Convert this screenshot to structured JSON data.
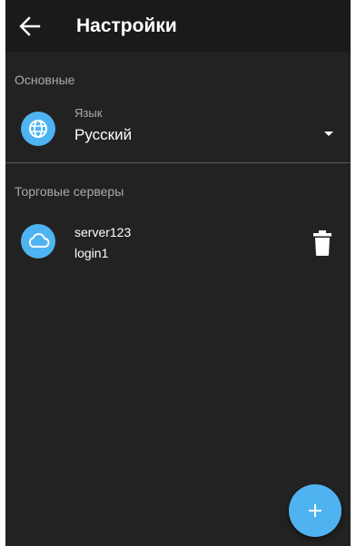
{
  "appbar": {
    "title": "Настройки",
    "back_icon": "arrow-left-icon"
  },
  "general": {
    "section_label": "Основные",
    "language": {
      "icon": "globe-icon",
      "caption": "Язык",
      "value": "Русский",
      "dropdown_icon": "dropdown-triangle-icon"
    }
  },
  "servers": {
    "section_label": "Торговые серверы",
    "items": [
      {
        "icon": "cloud-icon",
        "name": "server123",
        "login": "login1",
        "delete_icon": "trash-icon"
      }
    ]
  },
  "fab": {
    "icon": "plus-icon"
  },
  "colors": {
    "accent": "#4fb3f2",
    "background": "#222222",
    "appbar": "#1a1a1a",
    "text_primary": "#ffffff",
    "text_secondary": "#aaaaaa",
    "divider": "#5a5a5a"
  }
}
